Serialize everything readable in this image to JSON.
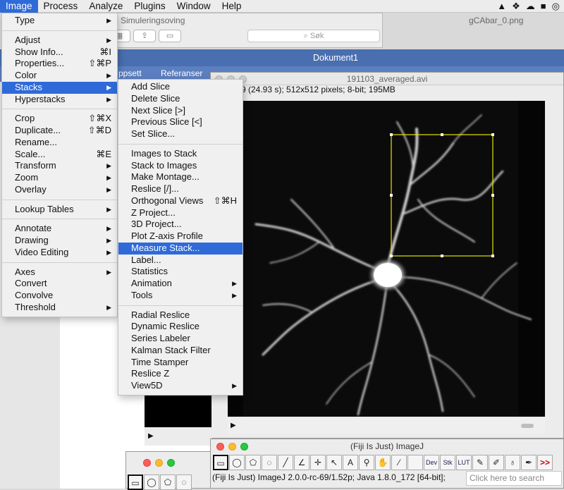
{
  "menubar": {
    "items": [
      "Image",
      "Process",
      "Analyze",
      "Plugins",
      "Window",
      "Help"
    ],
    "active": "Image",
    "tray_icons": [
      "vlc-icon",
      "dropbox-icon",
      "cloud-icon",
      "backup-icon",
      "creative-cloud-icon"
    ]
  },
  "finder": {
    "title": "Simuleringsoving",
    "search_placeholder": "Søk",
    "right_label": "gCAbar_0.png"
  },
  "word": {
    "doc_title": "Dokument1",
    "ribbon": [
      "ppsett",
      "Referanser"
    ]
  },
  "image_window": {
    "title": "191103_averaged.avi",
    "info": "9 (24.93 s); 512x512 pixels; 8-bit; 195MB"
  },
  "imagej": {
    "title": "(Fiji Is Just) ImageJ",
    "status": "(Fiji Is Just) ImageJ 2.0.0-rc-69/1.52p; Java 1.8.0_172 [64-bit];",
    "search_placeholder": "Click here to search",
    "tools": [
      "rectangle",
      "oval",
      "polygon",
      "freehand",
      "line",
      "angle",
      "point",
      "wand",
      "text",
      "magnifier",
      "hand",
      "dropper",
      "blank",
      "Dev",
      "Stk",
      "LUT",
      "pencil",
      "brush",
      "flood-fill",
      "pen",
      ">>"
    ]
  },
  "image_menu": {
    "items": [
      {
        "label": "Type",
        "submenu": true
      },
      {
        "sep": true
      },
      {
        "label": "Adjust",
        "submenu": true
      },
      {
        "label": "Show Info...",
        "shortcut": "⌘I"
      },
      {
        "label": "Properties...",
        "shortcut": "⇧⌘P"
      },
      {
        "label": "Color",
        "submenu": true
      },
      {
        "label": "Stacks",
        "submenu": true,
        "highlight": true
      },
      {
        "label": "Hyperstacks",
        "submenu": true
      },
      {
        "sep": true
      },
      {
        "label": "Crop",
        "shortcut": "⇧⌘X"
      },
      {
        "label": "Duplicate...",
        "shortcut": "⇧⌘D"
      },
      {
        "label": "Rename..."
      },
      {
        "label": "Scale...",
        "shortcut": "⌘E"
      },
      {
        "label": "Transform",
        "submenu": true
      },
      {
        "label": "Zoom",
        "submenu": true
      },
      {
        "label": "Overlay",
        "submenu": true
      },
      {
        "sep": true
      },
      {
        "label": "Lookup Tables",
        "submenu": true
      },
      {
        "sep": true
      },
      {
        "label": "Annotate",
        "submenu": true
      },
      {
        "label": "Drawing",
        "submenu": true
      },
      {
        "label": "Video Editing",
        "submenu": true
      },
      {
        "sep": true
      },
      {
        "label": "Axes",
        "submenu": true
      },
      {
        "label": "Convert"
      },
      {
        "label": "Convolve"
      },
      {
        "label": "Threshold",
        "submenu": true
      }
    ]
  },
  "stacks_menu": {
    "items": [
      {
        "label": "Add Slice"
      },
      {
        "label": "Delete Slice"
      },
      {
        "label": "Next Slice [>]"
      },
      {
        "label": "Previous Slice [<]"
      },
      {
        "label": "Set Slice..."
      },
      {
        "sep": true
      },
      {
        "label": "Images to Stack"
      },
      {
        "label": "Stack to Images"
      },
      {
        "label": "Make Montage..."
      },
      {
        "label": "Reslice [/]..."
      },
      {
        "label": "Orthogonal Views",
        "shortcut": "⇧⌘H"
      },
      {
        "label": "Z Project..."
      },
      {
        "label": "3D Project..."
      },
      {
        "label": "Plot Z-axis Profile"
      },
      {
        "label": "Measure Stack...",
        "highlight": true
      },
      {
        "label": "Label..."
      },
      {
        "label": "Statistics"
      },
      {
        "label": "Animation",
        "submenu": true
      },
      {
        "label": "Tools",
        "submenu": true
      },
      {
        "sep": true
      },
      {
        "label": "Radial Reslice"
      },
      {
        "label": "Dynamic Reslice"
      },
      {
        "label": "Series Labeler"
      },
      {
        "label": "Kalman Stack Filter"
      },
      {
        "label": "Time Stamper"
      },
      {
        "label": "Reslice Z"
      },
      {
        "label": "View5D",
        "submenu": true
      }
    ]
  },
  "colors": {
    "menu_highlight": "#2f6ad9",
    "roi": "#e6e600"
  }
}
